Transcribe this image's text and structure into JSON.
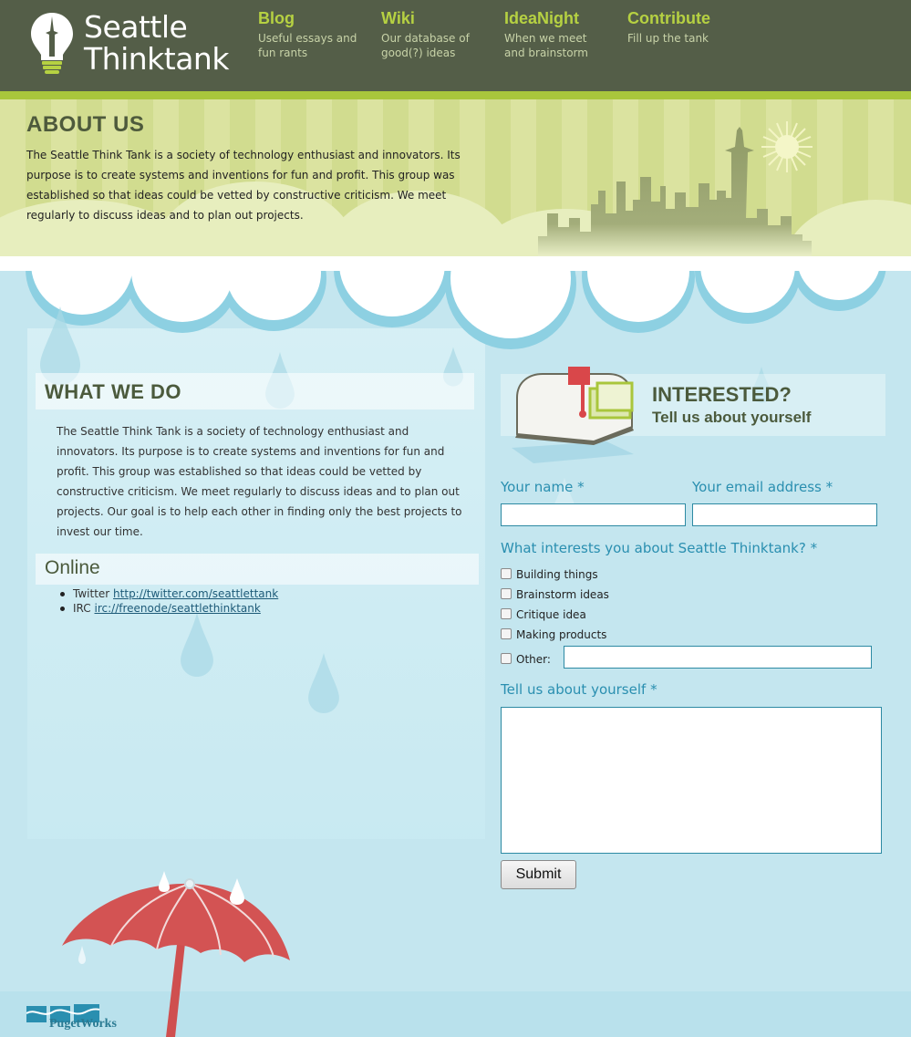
{
  "site": {
    "logo_line1": "Seattle",
    "logo_line2": "Thinktank"
  },
  "nav": [
    {
      "title": "Blog",
      "desc1": "Useful essays and",
      "desc2": "fun rants"
    },
    {
      "title": "Wiki",
      "desc1": "Our database of",
      "desc2": "good(?) ideas"
    },
    {
      "title": "IdeaNight",
      "desc1": "When we meet",
      "desc2": "and brainstorm"
    },
    {
      "title": "Contribute",
      "desc1": "Fill up the tank",
      "desc2": ""
    }
  ],
  "about": {
    "title": "ABOUT US",
    "text": "The Seattle Think Tank is a society of technology enthusiast and innovators. Its purpose is to create systems and inventions for fun and profit. This group was established so that ideas could be vetted by constructive criticism. We meet regularly to discuss ideas and to plan out projects."
  },
  "what_we_do": {
    "title": "WHAT WE DO",
    "text": "The Seattle Think Tank is a society of technology enthusiast and innovators. Its purpose is to create systems and inventions for fun and profit. This group was established so that ideas could be vetted by constructive criticism. We meet regularly to discuss ideas and to plan out projects. Our goal is to help each other in finding only the best projects to invest our time."
  },
  "online": {
    "title": "Online",
    "items": [
      {
        "label": "Twitter",
        "link": "http://twitter.com/seattlettank"
      },
      {
        "label": "IRC",
        "link": "irc://freenode/seattlethinktank"
      }
    ]
  },
  "form": {
    "title": "INTERESTED?",
    "subtitle": "Tell us about yourself",
    "name_label": "Your name *",
    "email_label": "Your email address *",
    "interests_label": "What interests you about Seattle Thinktank? *",
    "options": [
      "Building things",
      "Brainstorm ideas",
      "Critique idea",
      "Making products"
    ],
    "other_label": "Other:",
    "about_label": "Tell us about yourself *",
    "submit_label": "Submit"
  },
  "footer": {
    "brand": "PugetWorks"
  },
  "colors": {
    "header_bg": "#545e48",
    "accent_green": "#b6d142",
    "label_blue": "#2a8fb0",
    "title_dark": "#4b5a3c",
    "umbrella_red": "#cf4f4f"
  }
}
